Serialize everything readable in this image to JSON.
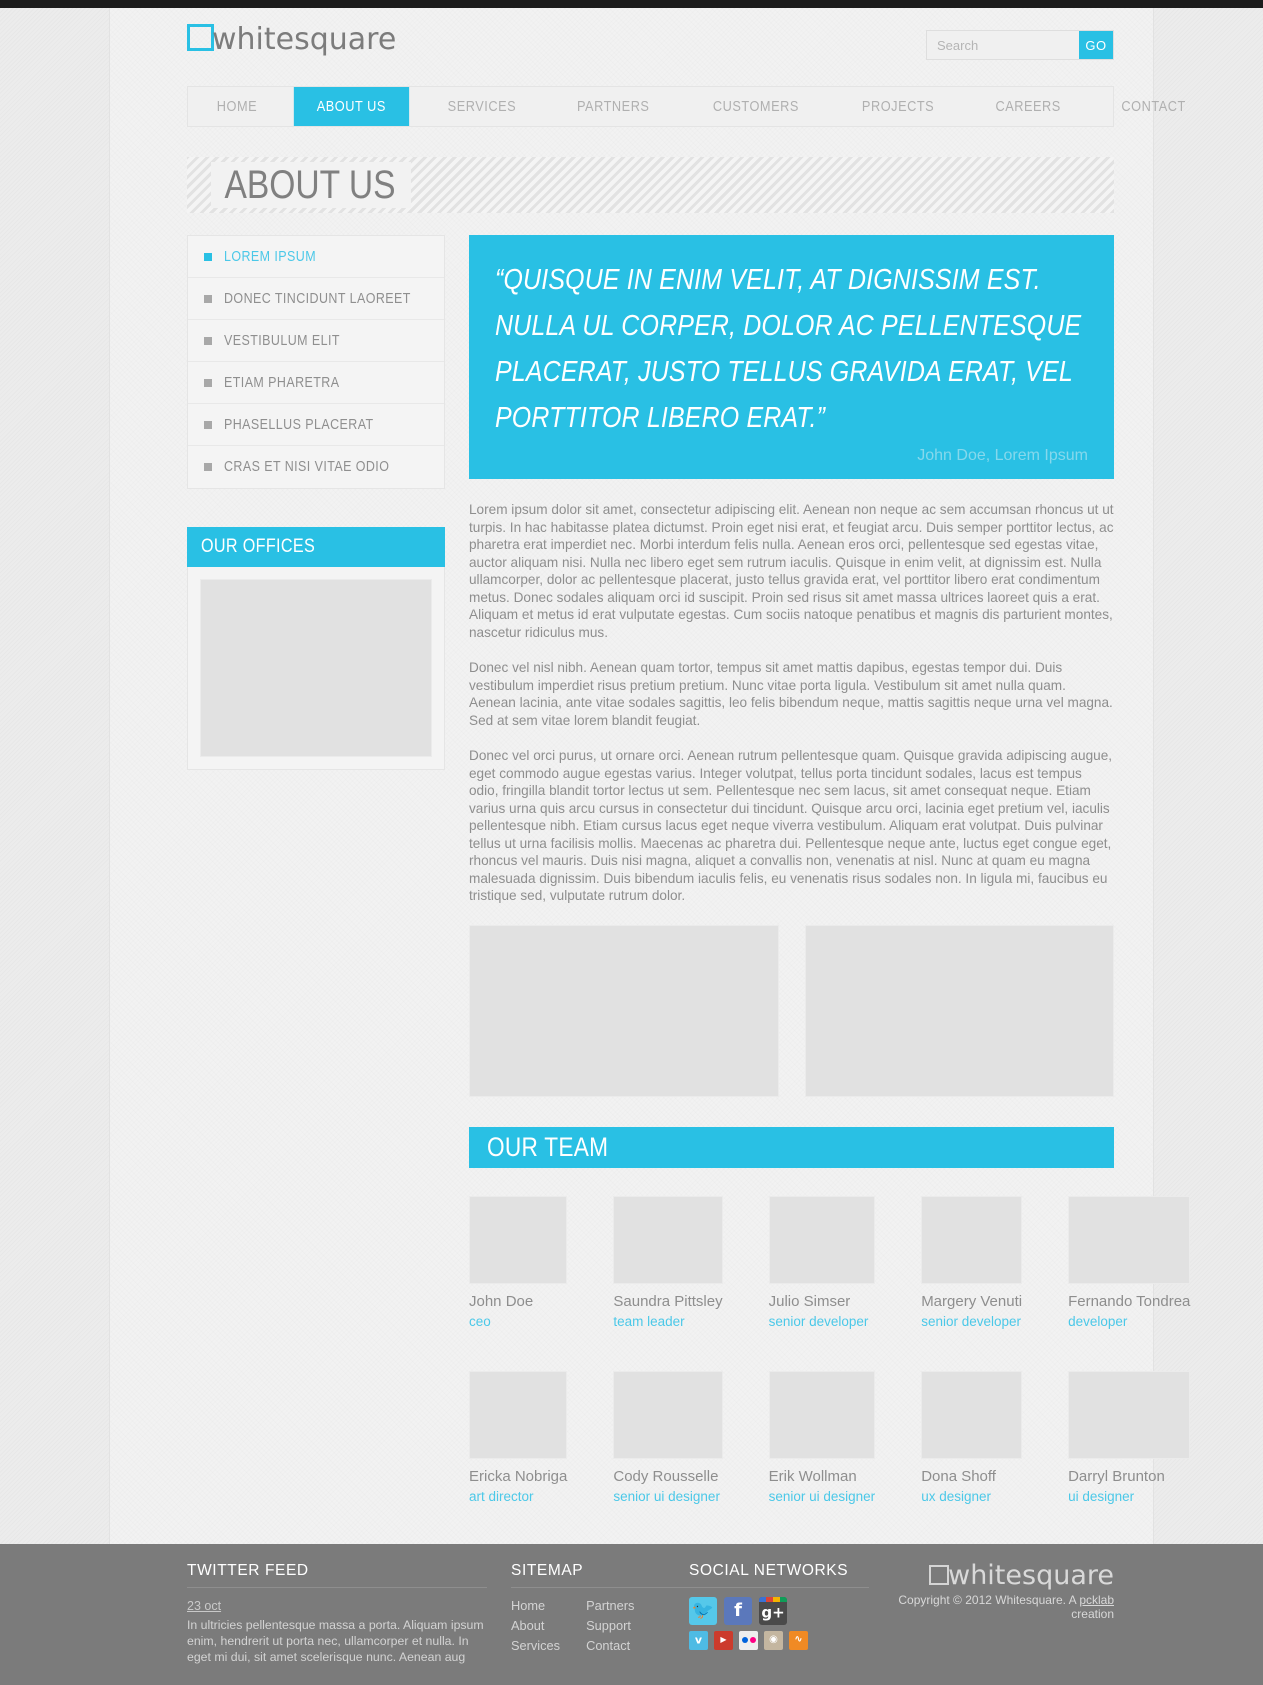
{
  "brand": {
    "name": "whitesquare",
    "logo_icon": "square-outline-icon",
    "accent_color": "#29c0e4"
  },
  "search": {
    "placeholder": "Search",
    "value": "",
    "button_label": "GO"
  },
  "nav": {
    "items": [
      {
        "label": "HOME",
        "active": false
      },
      {
        "label": "ABOUT US",
        "active": true
      },
      {
        "label": "SERVICES",
        "active": false
      },
      {
        "label": "PARTNERS",
        "active": false
      },
      {
        "label": "CUSTOMERS",
        "active": false
      },
      {
        "label": "PROJECTS",
        "active": false
      },
      {
        "label": "CAREERS",
        "active": false
      },
      {
        "label": "CONTACT",
        "active": false
      }
    ]
  },
  "page": {
    "title": "ABOUT US"
  },
  "sidebar": {
    "menu": [
      {
        "label": "LOREM IPSUM",
        "active": true
      },
      {
        "label": "DONEC TINCIDUNT LAOREET",
        "active": false
      },
      {
        "label": "VESTIBULUM ELIT",
        "active": false
      },
      {
        "label": "ETIAM PHARETRA",
        "active": false
      },
      {
        "label": "PHASELLUS PLACERAT",
        "active": false
      },
      {
        "label": "CRAS ET NISI VITAE ODIO",
        "active": false
      }
    ],
    "offices": {
      "title": "OUR OFFICES",
      "image_alt": "offices-map-placeholder"
    }
  },
  "quote": {
    "text": "“QUISQUE IN ENIM VELIT, AT DIGNISSIM EST. NULLA UL CORPER, DOLOR AC PELLENTESQUE PLACERAT, JUSTO TELLUS GRAVIDA ERAT, VEL PORTTITOR LIBERO ERAT.”",
    "author": "John Doe, Lorem Ipsum"
  },
  "article": {
    "paragraphs": [
      "Lorem ipsum dolor sit amet, consectetur adipiscing elit. Aenean non neque ac sem accumsan rhoncus ut ut turpis. In hac habitasse platea dictumst. Proin eget nisi erat, et feugiat arcu. Duis semper porttitor lectus, ac pharetra erat imperdiet nec. Morbi interdum felis nulla. Aenean eros orci, pellentesque sed egestas vitae, auctor aliquam nisi. Nulla nec libero eget sem rutrum iaculis. Quisque in enim velit, at dignissim est. Nulla ullamcorper, dolor ac pellentesque placerat, justo tellus gravida erat, vel porttitor libero erat condimentum metus. Donec sodales aliquam orci id suscipit. Proin sed risus sit amet massa ultrices laoreet quis a erat. Aliquam et metus id erat vulputate egestas. Cum sociis natoque penatibus et magnis dis parturient montes, nascetur ridiculus mus.",
      "Donec vel nisl nibh. Aenean quam tortor, tempus sit amet mattis dapibus, egestas tempor dui. Duis vestibulum imperdiet risus pretium pretium. Nunc vitae porta ligula. Vestibulum sit amet nulla quam. Aenean lacinia, ante vitae sodales sagittis, leo felis bibendum neque, mattis sagittis neque urna vel magna. Sed at sem vitae lorem blandit feugiat.",
      "Donec vel orci purus, ut ornare orci. Aenean rutrum pellentesque quam. Quisque gravida adipiscing augue, eget commodo augue egestas varius. Integer volutpat, tellus porta tincidunt sodales, lacus est tempus odio, fringilla blandit tortor lectus ut sem. Pellentesque nec sem lacus, sit amet consequat neque. Etiam varius urna quis arcu cursus in consectetur dui tincidunt. Quisque arcu orci, lacinia eget pretium vel, iaculis pellentesque nibh. Etiam cursus lacus eget neque viverra vestibulum. Aliquam erat volutpat. Duis pulvinar tellus ut urna facilisis mollis. Maecenas ac pharetra dui. Pellentesque neque ante, luctus eget congue eget, rhoncus vel mauris. Duis nisi magna, aliquet a convallis non, venenatis at nisl. Nunc at quam eu magna malesuada dignissim. Duis bibendum iaculis felis, eu venenatis risus sodales non. In ligula mi, faucibus eu tristique sed, vulputate rutrum dolor."
    ],
    "images": [
      "content-image-left",
      "content-image-right"
    ]
  },
  "team": {
    "title": "OUR TEAM",
    "members": [
      {
        "name": "John Doe",
        "role": "ceo"
      },
      {
        "name": "Saundra Pittsley",
        "role": "team leader"
      },
      {
        "name": "Julio Simser",
        "role": "senior developer"
      },
      {
        "name": "Margery Venuti",
        "role": "senior developer"
      },
      {
        "name": "Fernando Tondrea",
        "role": "developer"
      },
      {
        "name": "Ericka Nobriga",
        "role": "art director"
      },
      {
        "name": "Cody Rousselle",
        "role": "senior ui designer"
      },
      {
        "name": "Erik Wollman",
        "role": "senior ui designer"
      },
      {
        "name": "Dona Shoff",
        "role": "ux designer"
      },
      {
        "name": "Darryl Brunton",
        "role": "ui designer"
      }
    ]
  },
  "footer": {
    "twitter": {
      "title": "TWITTER FEED",
      "date": "23 oct",
      "text": "In ultricies pellentesque massa a porta. Aliquam ipsum enim, hendrerit ut porta nec, ullamcorper et nulla. In eget mi dui, sit amet scelerisque nunc. Aenean aug"
    },
    "sitemap": {
      "title": "SITEMAP",
      "col1": [
        "Home",
        "About",
        "Services"
      ],
      "col2": [
        "Partners",
        "Support",
        "Contact"
      ]
    },
    "social": {
      "title": "SOCIAL NETWORKS",
      "large": [
        {
          "name": "twitter-icon",
          "glyph": "✐"
        },
        {
          "name": "facebook-icon",
          "glyph": "f"
        },
        {
          "name": "google-plus-icon",
          "glyph": "g+"
        }
      ],
      "small": [
        {
          "name": "vimeo-icon",
          "glyph": "v"
        },
        {
          "name": "youtube-icon",
          "glyph": "▶"
        },
        {
          "name": "flickr-icon",
          "glyph": ""
        },
        {
          "name": "instagram-icon",
          "glyph": "◉"
        },
        {
          "name": "rss-icon",
          "glyph": "◠"
        }
      ]
    },
    "brand": {
      "name": "whitesquare",
      "copyright_prefix": "Copyright © 2012 Whitesquare. A ",
      "copyright_link": "pcklab",
      "copyright_suffix": " creation"
    }
  }
}
